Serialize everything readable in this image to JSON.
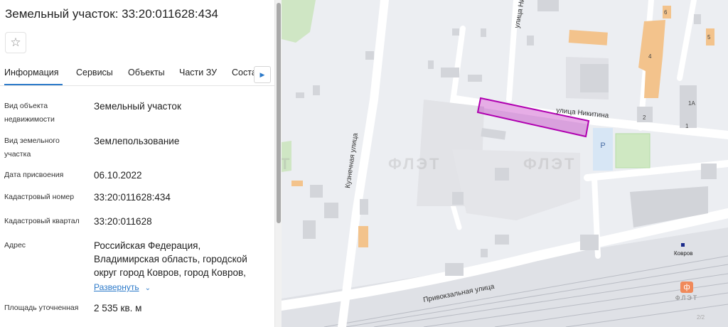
{
  "panel": {
    "title": "Земельный участок: 33:20:011628:434",
    "favorite_icon": "star-icon",
    "tabs": [
      {
        "label": "Информация",
        "active": true
      },
      {
        "label": "Сервисы"
      },
      {
        "label": "Объекты"
      },
      {
        "label": "Части ЗУ"
      },
      {
        "label": "Соста"
      }
    ],
    "tabs_next_icon": "chevron-right-icon",
    "fields": [
      {
        "label": "Вид объекта недвижимости",
        "value": "Земельный участок"
      },
      {
        "label": "Вид земельного участка",
        "value": "Землепользование"
      },
      {
        "label": "Дата присвоения",
        "value": "06.10.2022"
      },
      {
        "label": "Кадастровый номер",
        "value": "33:20:011628:434"
      },
      {
        "label": "Кадастровый квартал",
        "value": "33:20:011628"
      },
      {
        "label": "Адрес",
        "value": "Российская Федерация, Владимирская область, городской округ город Ковров, город Ковров,",
        "more": "Развернуть"
      },
      {
        "label": "Площадь уточненная",
        "value": "2 535 кв. м"
      }
    ]
  },
  "map": {
    "street_labels": {
      "nikitina": "улица Никитина",
      "nikitina_top": "улица Ники",
      "kuznechnaya": "Кузнечная улица",
      "privokzalnaya": "Привокзальная улица"
    },
    "station_label": "Ковров",
    "parking_label": "P",
    "house_numbers": {
      "h6": "6",
      "h5": "5",
      "h4": "4",
      "h2": "2",
      "h1a": "1А",
      "h1": "1"
    },
    "watermark": "ФЛЭТ",
    "brand_logo": "flat-logo",
    "page_indicator": "2/2",
    "colors": {
      "parcel": "#b000b0",
      "building_orange": "#f3c38c",
      "park": "#cfe8c2",
      "parking": "#d7e6f5"
    }
  }
}
